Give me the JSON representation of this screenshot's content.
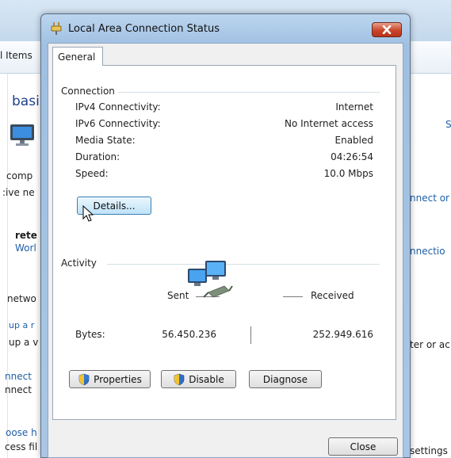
{
  "background": {
    "address_crumb": "l Items",
    "heading": "basi",
    "rows": [
      {
        "text": "comp",
        "style": "plain"
      },
      {
        "text": ":ive ne",
        "style": "plain"
      },
      {
        "text": "rete",
        "style": "bold"
      },
      {
        "text": "Worl",
        "style": "link"
      },
      {
        "text": "netwo",
        "style": "plain"
      },
      {
        "text": "up a r",
        "style": "link"
      },
      {
        "text": "up a v",
        "style": "plain"
      },
      {
        "text": "nnect",
        "style": "link"
      },
      {
        "text": "nnect",
        "style": "plain"
      },
      {
        "text": "oose h",
        "style": "link"
      },
      {
        "text": "cess fil",
        "style": "plain"
      }
    ],
    "right_rows": [
      {
        "text": "S",
        "style": "link"
      },
      {
        "text": "nnect or",
        "style": "link"
      },
      {
        "text": "nnectio",
        "style": "link"
      },
      {
        "text": "ter or ac",
        "style": "plain"
      },
      {
        "text": "settings",
        "style": "plain"
      }
    ]
  },
  "dialog": {
    "title": "Local Area Connection Status",
    "tab_general": "General",
    "connection": {
      "group_label": "Connection",
      "rows": [
        {
          "label": "IPv4 Connectivity:",
          "value": "Internet"
        },
        {
          "label": "IPv6 Connectivity:",
          "value": "No Internet access"
        },
        {
          "label": "Media State:",
          "value": "Enabled"
        },
        {
          "label": "Duration:",
          "value": "04:26:54"
        },
        {
          "label": "Speed:",
          "value": "10.0 Mbps"
        }
      ],
      "details_button": "Details..."
    },
    "activity": {
      "group_label": "Activity",
      "sent_label": "Sent",
      "received_label": "Received",
      "bytes_label": "Bytes:",
      "bytes_sent": "56.450.236",
      "bytes_received": "252.949.616"
    },
    "buttons": {
      "properties": "Properties",
      "disable": "Disable",
      "diagnose": "Diagnose",
      "close": "Close"
    }
  },
  "icons": {
    "title_icon": "network-plug-icon",
    "close_icon": "close-x-icon",
    "shield_icon": "uac-shield-icon",
    "network_activity_icon": "network-computers-icon",
    "cursor": "mouse-pointer-icon"
  }
}
